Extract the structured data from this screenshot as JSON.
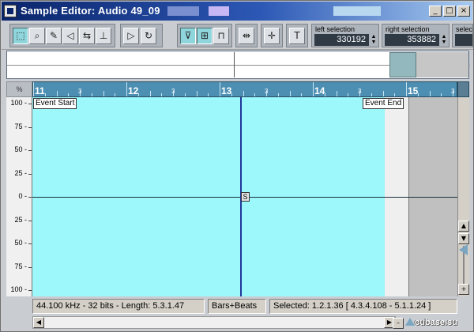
{
  "window": {
    "title": "Sample Editor: Audio 49_09",
    "minimize_label": "_",
    "maximize_label": "□",
    "close_label": "×"
  },
  "toolbar": {
    "tools": [
      {
        "name": "range-selection-icon",
        "glyph": "⬚",
        "active": true
      },
      {
        "name": "magnifier-icon",
        "glyph": "🔍",
        "active": false
      },
      {
        "name": "pencil-icon",
        "glyph": "✎",
        "active": false
      },
      {
        "name": "speaker-icon",
        "glyph": "🔈",
        "active": false
      },
      {
        "name": "scrub-icon",
        "glyph": "⇆",
        "active": false
      },
      {
        "name": "lock-icon",
        "glyph": "🔒",
        "active": false
      }
    ],
    "play_icon": "▷",
    "loop_icon": "↻",
    "snap_icon": "⊽",
    "grid_icon": "⊞",
    "bracket_icon": "⊓",
    "hitpoint_icon": "⇹",
    "crosshair_icon": "✛",
    "marker_icon": "T",
    "left_selection_label": "left selection",
    "left_selection_value": "330192",
    "right_selection_label": "right selection",
    "right_selection_value": "353882",
    "select_label": "selec",
    "spin_up": "▲",
    "spin_down": "▼"
  },
  "ruler": {
    "corner": "%",
    "bars": [
      {
        "num": "11"
      },
      {
        "num": "12"
      },
      {
        "num": "13"
      },
      {
        "num": "14"
      },
      {
        "num": "15"
      }
    ],
    "beat_label": "3"
  },
  "scale": {
    "labels": [
      "100",
      "75",
      "50",
      "25",
      "0",
      "25",
      "50",
      "75",
      "100"
    ],
    "minus": "-"
  },
  "wave": {
    "event_start": "Event Start",
    "event_end": "Event End",
    "sync_label": "S"
  },
  "scroll": {
    "up": "▲",
    "down": "▼",
    "minus": "–",
    "plus": "+",
    "left": "◀",
    "right": "▶"
  },
  "status": {
    "format": "44.100 kHz - 32 bits - Length:   5.3.1.47",
    "mode": "Bars+Beats",
    "selected": "Selected:   1.2.1.36 [  4.3.4.108 -   5.1.1.24 ]"
  },
  "watermark": "cubase.su"
}
